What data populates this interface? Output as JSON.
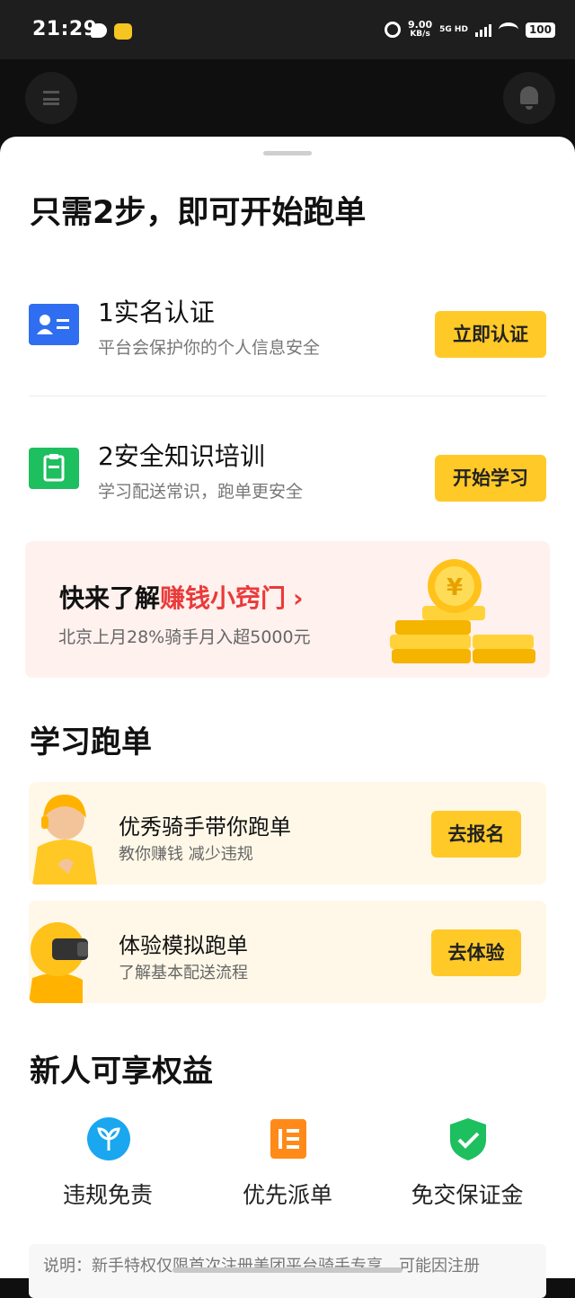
{
  "status_bar": {
    "time": "21:29",
    "net_speed_value": "9.00",
    "net_speed_unit": "KB/s",
    "network": "5G HD",
    "battery": "100"
  },
  "heading": "只需2步，即可开始跑单",
  "steps": [
    {
      "title": "1实名认证",
      "subtitle": "平台会保护你的个人信息安全",
      "button": "立即认证",
      "icon": "id-card-icon",
      "icon_color": "#2f6ef0"
    },
    {
      "title": "2安全知识培训",
      "subtitle": "学习配送常识，跑单更安全",
      "button": "开始学习",
      "icon": "clipboard-icon",
      "icon_color": "#1dbf5f"
    }
  ],
  "banner": {
    "lead_prefix": "快来了解",
    "lead_highlight": "赚钱小窍门",
    "chevron": "›",
    "subtitle": "北京上月28%骑手月入超5000元"
  },
  "learn_section": {
    "title": "学习跑单",
    "cards": [
      {
        "title": "优秀骑手带你跑单",
        "subtitle": "教你赚钱 减少违规",
        "button": "去报名"
      },
      {
        "title": "体验模拟跑单",
        "subtitle": "了解基本配送流程",
        "button": "去体验"
      }
    ]
  },
  "benefits_section": {
    "title": "新人可享权益",
    "items": [
      {
        "label": "违规免责",
        "icon": "sprout-icon",
        "color": "#1aa7f0"
      },
      {
        "label": "优先派单",
        "icon": "priority-list-icon",
        "color": "#ff8a1a"
      },
      {
        "label": "免交保证金",
        "icon": "shield-check-icon",
        "color": "#1dbf5f"
      }
    ]
  },
  "note": "说明：新手特权仅限首次注册美团平台骑手专享，可能因注册"
}
